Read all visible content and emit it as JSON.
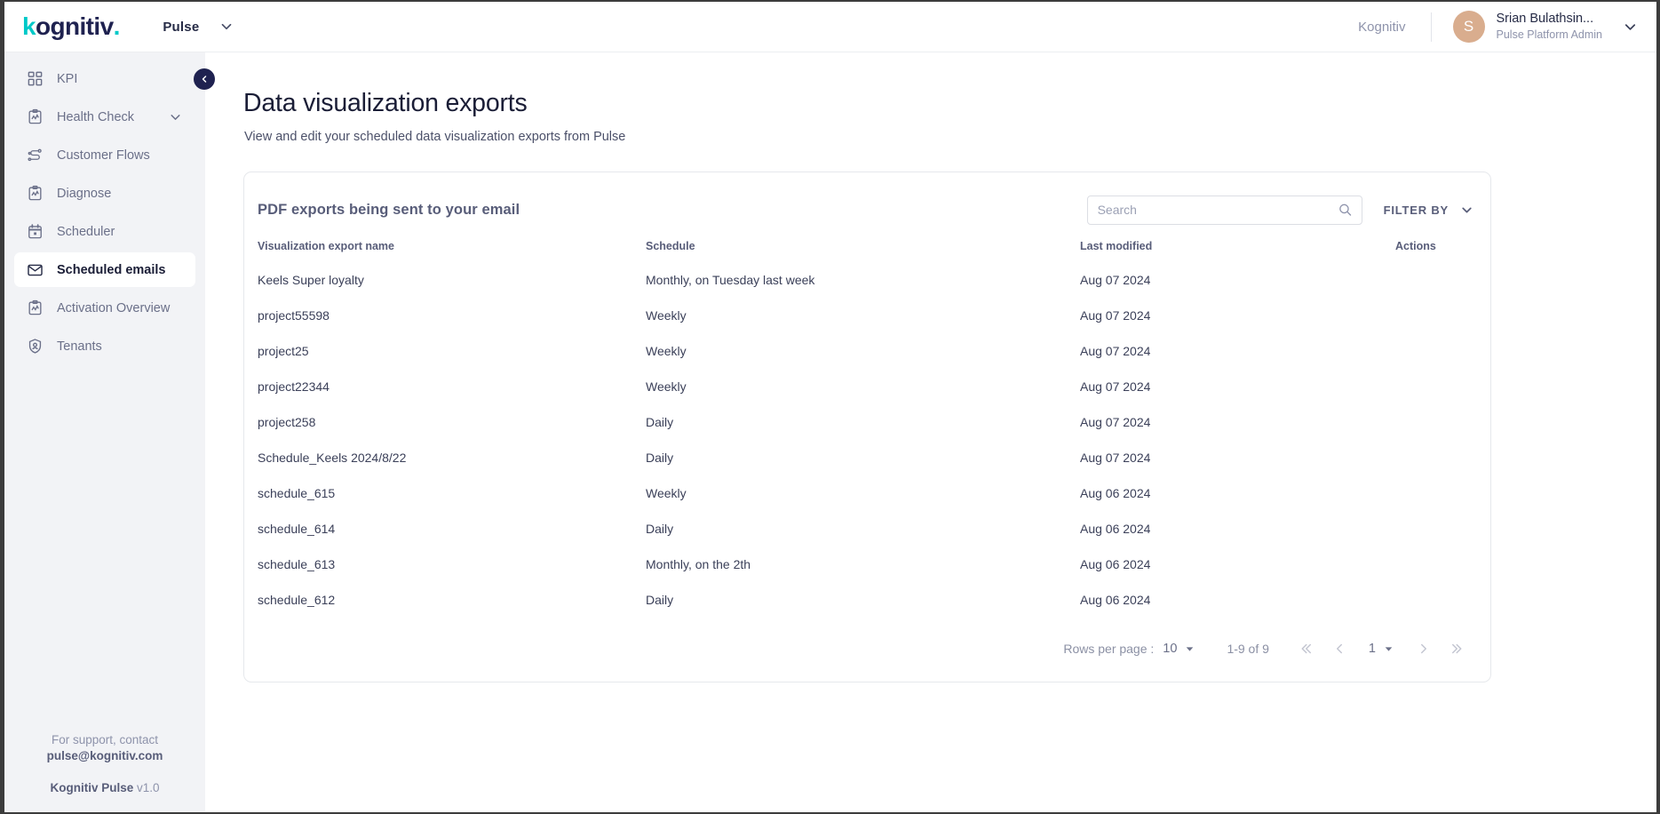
{
  "topbar": {
    "logo_text_1": "k",
    "logo_text_2": "ognitiv",
    "logo_dot": ".",
    "app_name": "Pulse",
    "tenant": "Kognitiv",
    "avatar_initial": "S",
    "user_name": "Srian Bulathsin...",
    "user_role": "Pulse Platform Admin"
  },
  "sidebar": {
    "items": [
      {
        "label": "KPI",
        "icon": "grid-icon",
        "active": false,
        "expandable": false
      },
      {
        "label": "Health Check",
        "icon": "clipboard-chart-icon",
        "active": false,
        "expandable": true
      },
      {
        "label": "Customer Flows",
        "icon": "flow-icon",
        "active": false,
        "expandable": false
      },
      {
        "label": "Diagnose",
        "icon": "clipboard-chart-icon",
        "active": false,
        "expandable": false
      },
      {
        "label": "Scheduler",
        "icon": "calendar-icon",
        "active": false,
        "expandable": false
      },
      {
        "label": "Scheduled emails",
        "icon": "envelope-icon",
        "active": true,
        "expandable": false
      },
      {
        "label": "Activation Overview",
        "icon": "clipboard-chart-icon",
        "active": false,
        "expandable": false
      },
      {
        "label": "Tenants",
        "icon": "shield-user-icon",
        "active": false,
        "expandable": false
      }
    ],
    "footer": {
      "support_line1": "For support, contact",
      "support_email": "pulse@kognitiv.com",
      "product": "Kognitiv Pulse",
      "version": "v1.0"
    },
    "collapse_icon": "chevron-left-icon"
  },
  "main": {
    "title": "Data visualization exports",
    "subtitle": "View and edit your scheduled data visualization exports from Pulse",
    "card": {
      "title": "PDF exports being sent to your email",
      "search_placeholder": "Search",
      "search_value": "",
      "filter_by_label": "FILTER BY",
      "columns": [
        "Visualization export name",
        "Schedule",
        "Last modified",
        "Actions"
      ],
      "rows": [
        {
          "name": "Keels Super loyalty",
          "schedule": "Monthly, on Tuesday last week",
          "modified": "Aug 07 2024",
          "actions": ""
        },
        {
          "name": "project55598",
          "schedule": "Weekly",
          "modified": "Aug 07 2024",
          "actions": ""
        },
        {
          "name": "project25",
          "schedule": "Weekly",
          "modified": "Aug 07 2024",
          "actions": ""
        },
        {
          "name": "project22344",
          "schedule": "Weekly",
          "modified": "Aug 07 2024",
          "actions": ""
        },
        {
          "name": "project258",
          "schedule": "Daily",
          "modified": "Aug 07 2024",
          "actions": ""
        },
        {
          "name": "Schedule_Keels 2024/8/22",
          "schedule": "Daily",
          "modified": "Aug 07 2024",
          "actions": ""
        },
        {
          "name": "schedule_615",
          "schedule": "Weekly",
          "modified": "Aug 06 2024",
          "actions": ""
        },
        {
          "name": "schedule_614",
          "schedule": "Daily",
          "modified": "Aug 06 2024",
          "actions": ""
        },
        {
          "name": "schedule_613",
          "schedule": "Monthly, on the 2th",
          "modified": "Aug 06 2024",
          "actions": ""
        },
        {
          "name": "schedule_612",
          "schedule": "Daily",
          "modified": "Aug 06 2024",
          "actions": ""
        }
      ],
      "pagination": {
        "rows_per_page_label": "Rows per page :",
        "rows_per_page_value": "10",
        "range_text": "1-9 of 9",
        "page_value": "1",
        "first_icon": "double-chevron-left-icon",
        "prev_icon": "chevron-left-icon",
        "next_icon": "chevron-right-icon",
        "last_icon": "double-chevron-right-icon"
      }
    }
  },
  "colors": {
    "brand_navy": "#1f2250",
    "brand_teal": "#00c9c8",
    "sidebar_bg": "#f2f3f6",
    "avatar_bg": "#d9ad8e",
    "text_muted": "#8e93ab",
    "card_border": "#e6e8ec"
  }
}
